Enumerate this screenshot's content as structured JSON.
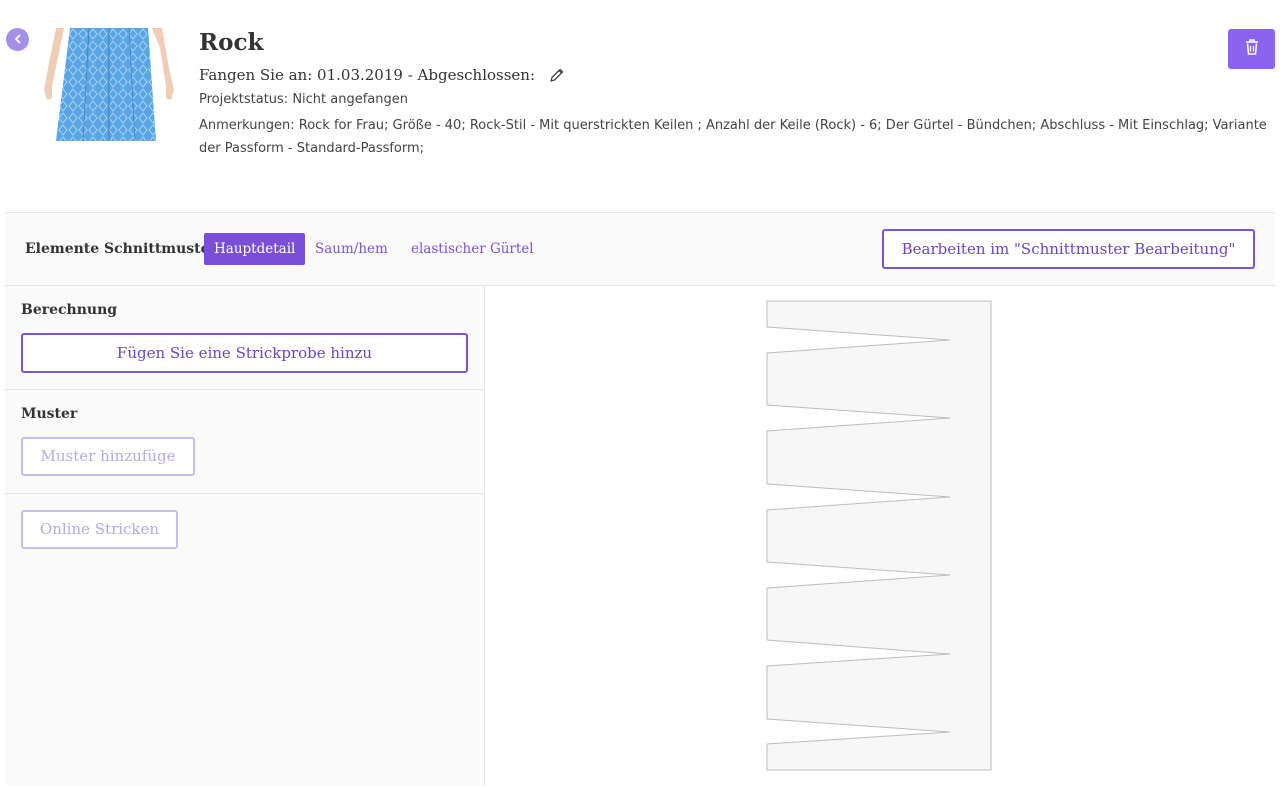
{
  "header": {
    "title": "Rock",
    "dates": "Fangen Sie an: 01.03.2019 - Abgeschlossen:",
    "status": "Projektstatus: Nicht angefangen",
    "notes": "Anmerkungen: Rock for Frau; Größe - 40; Rock-Stil - Mit querstrickten Keilen ; Anzahl der Keile (Rock) - 6; Der Gürtel - Bündchen; Abschluss - Mit Einschlag; Variante der Passform - Standard-Passform;"
  },
  "icons": {
    "back": "chevron-left-icon",
    "edit": "pencil-icon",
    "delete": "trash-icon"
  },
  "tabs_bar": {
    "label": "Elemente Schnittmuster",
    "tabs": [
      "Hauptdetail",
      "Saum/hem",
      "elastischer Gürtel"
    ],
    "active_tab": "Hauptdetail",
    "editor_button": "Bearbeiten im \"Schnittmuster Bearbeitung\""
  },
  "sections": {
    "calculation": {
      "title": "Berechnung",
      "button": "Fügen Sie eine Strickprobe hinzu"
    },
    "pattern": {
      "title": "Muster",
      "button": "Muster hinzufüge"
    },
    "online_button": "Online Stricken"
  },
  "colors": {
    "accent": "#7a4fd8",
    "disabled": "#c9bdf0"
  }
}
